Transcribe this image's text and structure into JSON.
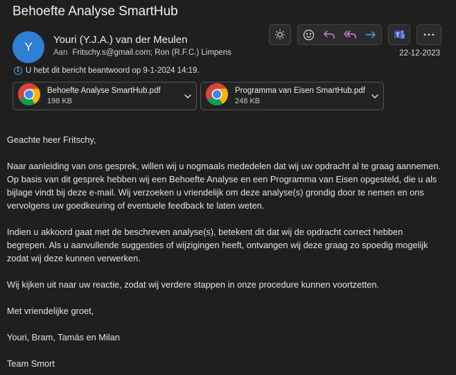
{
  "email": {
    "subject": "Behoefte Analyse SmartHub",
    "avatar_initial": "Y",
    "sender": "Youri (Y.J.A.) van der Meulen",
    "to_label": "Aan",
    "to_value": "Fritschy.s@gmail.com; Ron (R.F.C.) Limpens",
    "date": "22-12-2023",
    "reply_info": "U hebt dit bericht beantwoord op 9-1-2024 14:19."
  },
  "toolbar": {
    "buttons": [
      "brightness-icon",
      "emoji-icon",
      "reply-icon",
      "reply-all-icon",
      "forward-icon",
      "teams-icon",
      "more-icon"
    ]
  },
  "attachments": [
    {
      "name": "Behoefte Analyse SmartHub.pdf",
      "size": "198 KB"
    },
    {
      "name": "Programma van Eisen SmartHub.pdf",
      "size": "248 KB"
    }
  ],
  "body": {
    "greeting": "Geachte heer Fritschy,",
    "p1": "Naar aanleiding van ons gesprek, willen wij u nogmaals mededelen dat wij uw opdracht al te graag aannemen. Op basis van dit gesprek hebben wij een Behoefte Analyse en een Programma van Eisen opgesteld, die u als bijlage vindt bij deze e-mail. Wij verzoeken u vriendelijk om deze analyse(s) grondig door te nemen en ons vervolgens uw goedkeuring of eventuele feedback te laten weten.",
    "p2": "Indien u akkoord gaat met de beschreven analyse(s), betekent dit dat wij de opdracht correct hebben begrepen. Als u aanvullende suggesties of wijzigingen heeft, ontvangen wij deze graag zo spoedig mogelijk zodat wij deze kunnen verwerken.",
    "p3": "Wij kijken uit naar uw reactie, zodat wij verdere stappen in onze procedure kunnen voortzetten.",
    "closing": "Met vriendelijke groet,",
    "names": "Youri, Bram, Tamás en Milan",
    "team": "Team Smort"
  },
  "colors": {
    "accent": "#4ea1e8",
    "avatar": "#2f7fd2",
    "background": "#1f1f1f"
  }
}
